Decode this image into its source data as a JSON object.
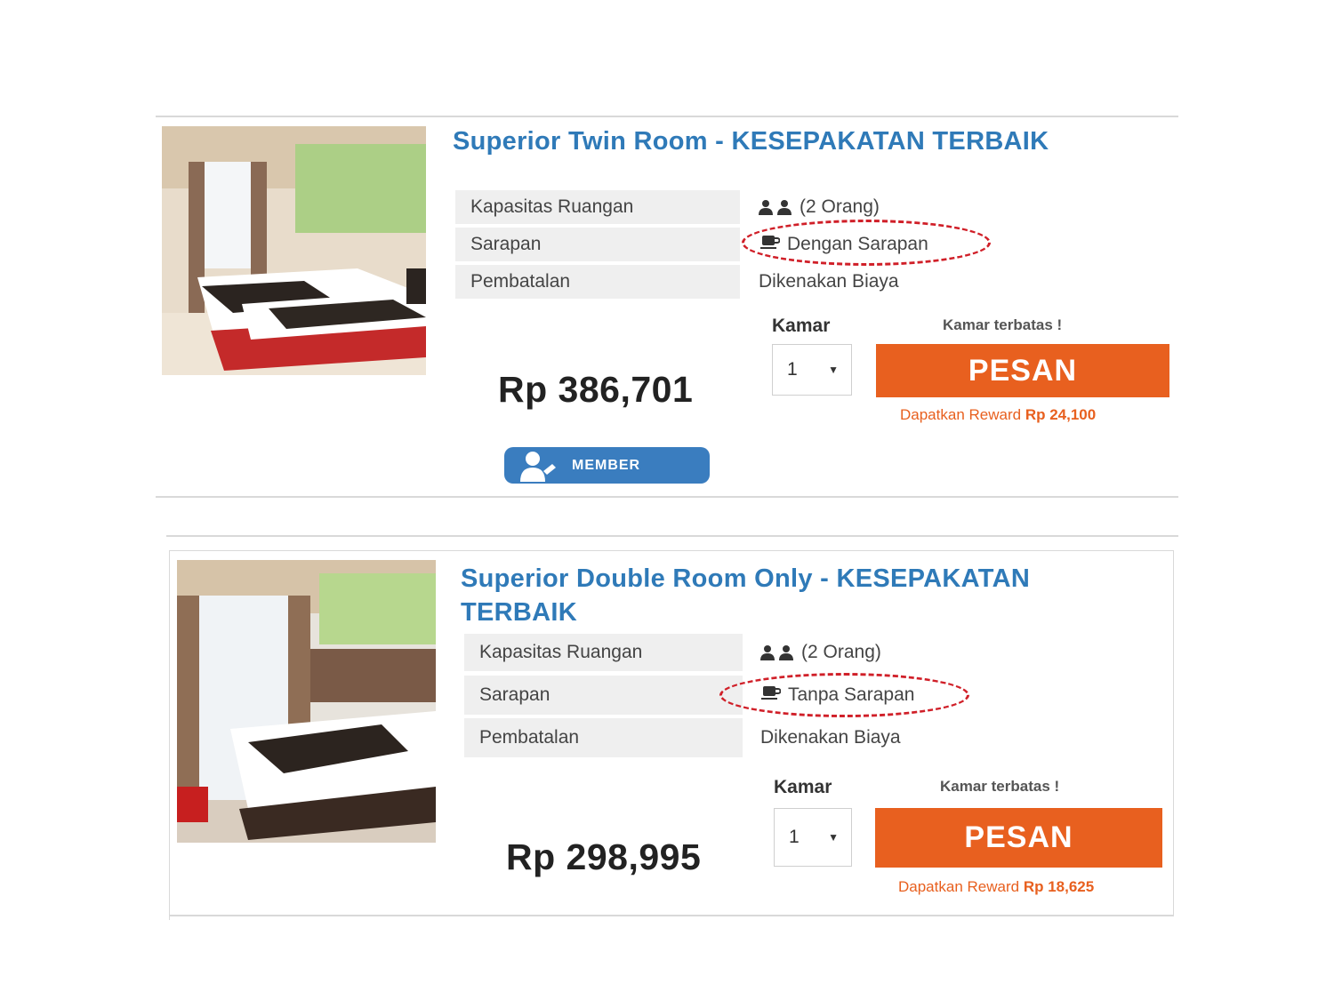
{
  "rooms": [
    {
      "title": "Superior Twin Room - KESEPAKATAN TERBAIK",
      "specs": [
        {
          "label": "Kapasitas Ruangan",
          "value": "(2 Orang)",
          "icon": "person-icon"
        },
        {
          "label": "Sarapan",
          "value": "Dengan Sarapan",
          "icon": "coffee-cup-icon"
        },
        {
          "label": "Pembatalan",
          "value": "Dikenakan Biaya"
        }
      ],
      "price": "Rp 386,701",
      "kamar_label": "Kamar",
      "quantity": "1",
      "limited_text": "Kamar terbatas !",
      "book_label": "PESAN",
      "reward_prefix": "Dapatkan Reward",
      "reward_amount": "Rp 24,100",
      "member_label": "MEMBER"
    },
    {
      "title_line1": "Superior Double Room Only - KESEPAKATAN",
      "title_line2": "TERBAIK",
      "specs": [
        {
          "label": "Kapasitas Ruangan",
          "value": "(2 Orang)",
          "icon": "person-icon"
        },
        {
          "label": "Sarapan",
          "value": "Tanpa Sarapan",
          "icon": "coffee-cup-icon"
        },
        {
          "label": "Pembatalan",
          "value": "Dikenakan Biaya"
        }
      ],
      "price": "Rp 298,995",
      "kamar_label": "Kamar",
      "quantity": "1",
      "limited_text": "Kamar terbatas !",
      "book_label": "PESAN",
      "reward_prefix": "Dapatkan Reward",
      "reward_amount": "Rp 18,625"
    }
  ],
  "colors": {
    "title_blue": "#2f7ab8",
    "book_orange": "#e8601f",
    "highlight_red": "#d01f28",
    "member_blue": "#3a7dbf"
  }
}
